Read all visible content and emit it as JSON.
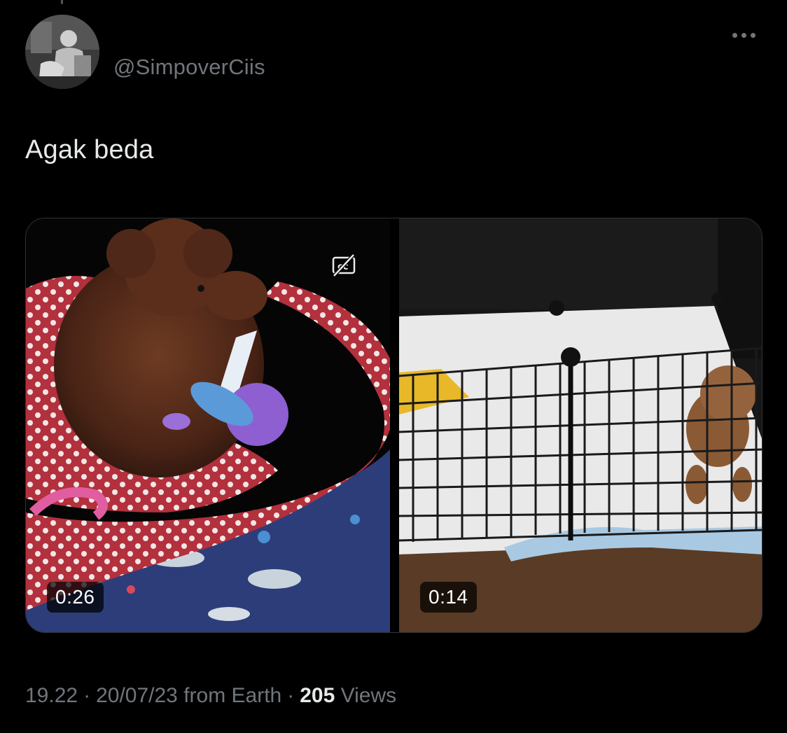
{
  "tweet": {
    "handle": "@SimpoverCiis",
    "text": "Agak beda",
    "time": "19.22",
    "date": "20/07/23",
    "location": "from Earth",
    "views_count": "205",
    "views_label": "Views",
    "separator": "·"
  },
  "media": [
    {
      "duration": "0:26",
      "has_captions_icon": true
    },
    {
      "duration": "0:14",
      "has_captions_icon": false
    }
  ],
  "icons": {
    "more": "more-horizontal-icon",
    "captions": "closed-captions-off-icon"
  },
  "colors": {
    "background": "#000000",
    "text_primary": "#e7e9ea",
    "text_secondary": "#71767b"
  }
}
